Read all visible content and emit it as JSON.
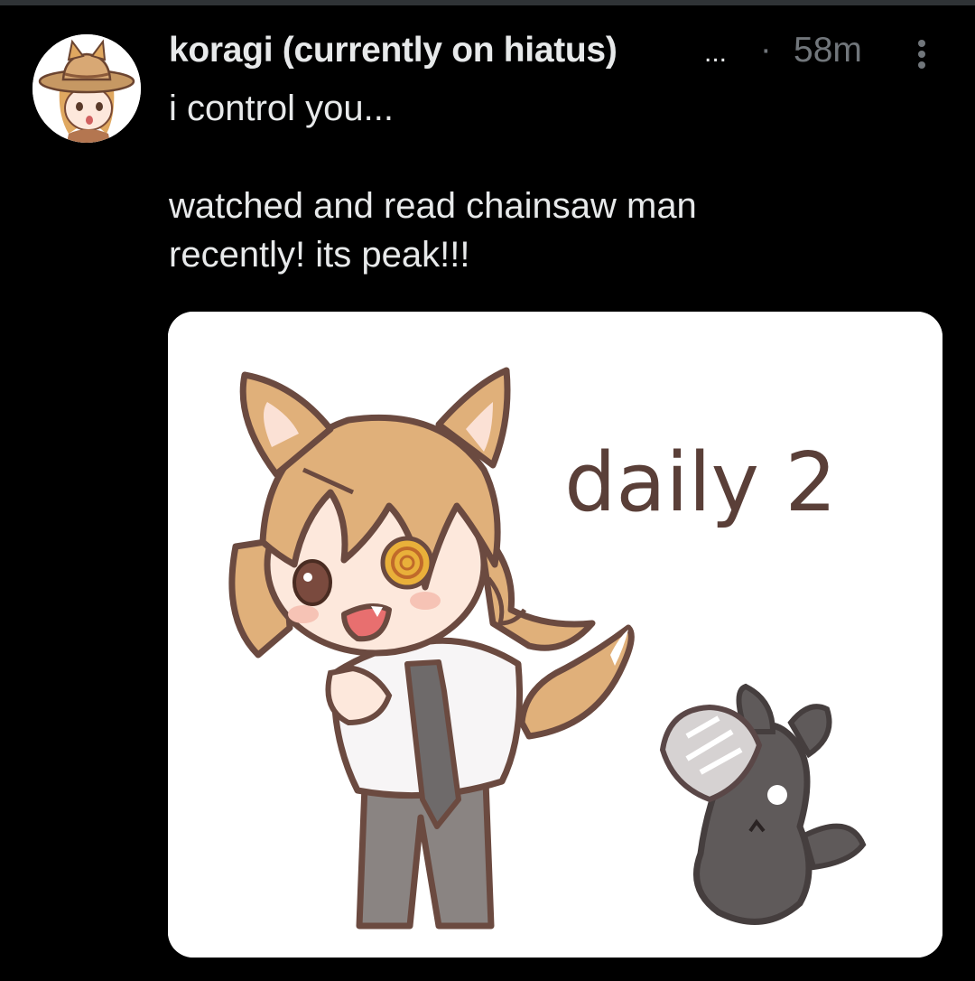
{
  "tweet": {
    "display_name": "koragi (currently on hiatus)",
    "name_truncation": "...",
    "separator": "·",
    "timestamp": "58m",
    "text_lines": [
      "i control you...",
      "watched and read chainsaw man",
      "recently! its peak!!!"
    ],
    "more_icon": "vertical-ellipsis-icon",
    "avatar_icon": "avatar-image"
  },
  "media": {
    "caption_text": "daily 2",
    "image_icon": "illustration-image"
  },
  "colors": {
    "background": "#000000",
    "primary_text": "#e7e9ea",
    "secondary_text": "#71767b",
    "divider": "#2f3336"
  }
}
